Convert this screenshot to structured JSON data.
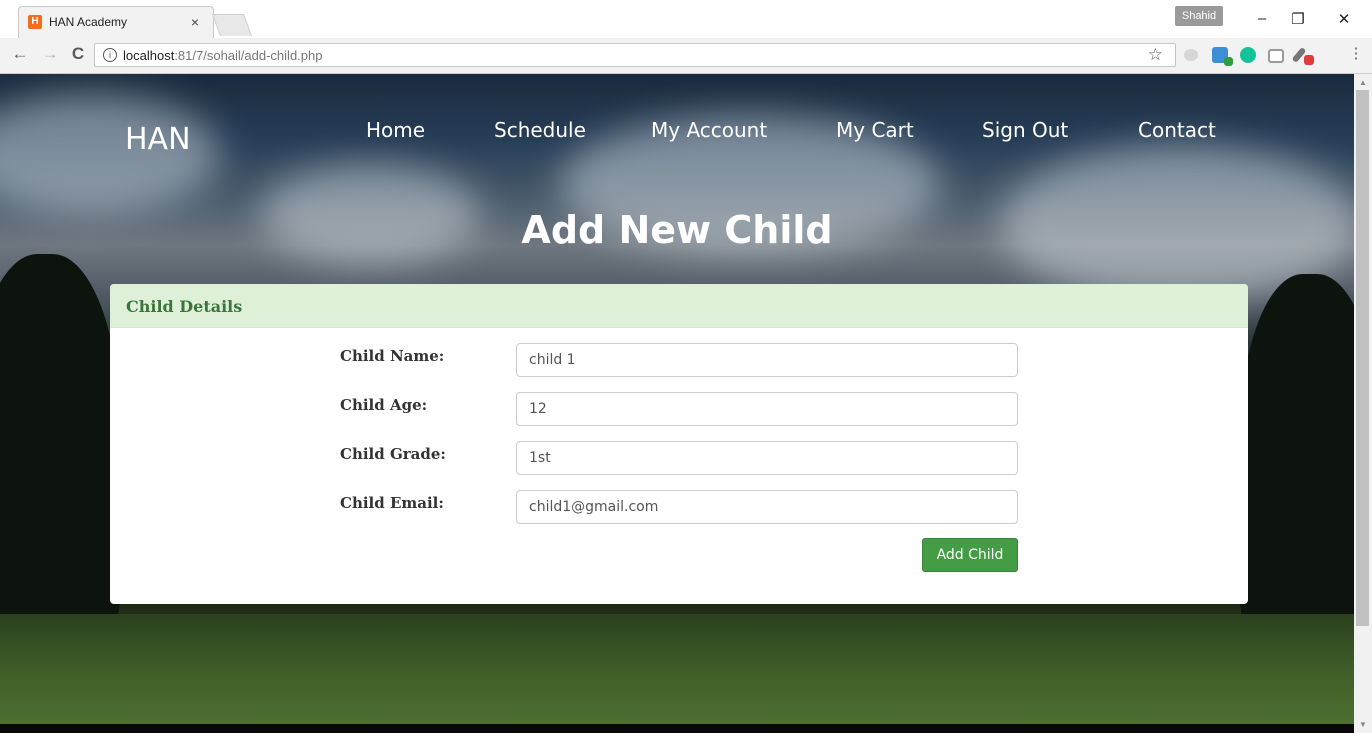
{
  "browser": {
    "tab_title": "HAN Academy",
    "tab_close": "×",
    "favicon_glyph": "H",
    "profile_name": "Shahid",
    "url_host": "localhost",
    "url_rest": ":81/7/sohail/add-child.php",
    "win_minimize": "–",
    "win_restore": "❐",
    "win_close": "✕",
    "back": "←",
    "forward": "→",
    "reload": "C",
    "info": "i",
    "star": "☆",
    "extension_icons": [
      "cloud-extension-icon",
      "grammar-extension-icon",
      "grammarly-icon",
      "camera-extension-icon",
      "eyedropper-extension-icon"
    ]
  },
  "nav": {
    "brand": "HAN",
    "items": [
      "Home",
      "Schedule",
      "My Account",
      "My Cart",
      "Sign Out",
      "Contact"
    ]
  },
  "hero": {
    "title": "Add New Child"
  },
  "form": {
    "panel_title": "Child Details",
    "fields": [
      {
        "label": "Child Name:",
        "value": "child 1"
      },
      {
        "label": "Child Age:",
        "value": "12"
      },
      {
        "label": "Child Grade:",
        "value": "1st"
      },
      {
        "label": "Child Email:",
        "value": "child1@gmail.com"
      }
    ],
    "submit_label": "Add Child"
  },
  "colors": {
    "panel_heading_bg": "#dff0d8",
    "panel_heading_text": "#3c763d",
    "submit_bg": "#449d44"
  }
}
